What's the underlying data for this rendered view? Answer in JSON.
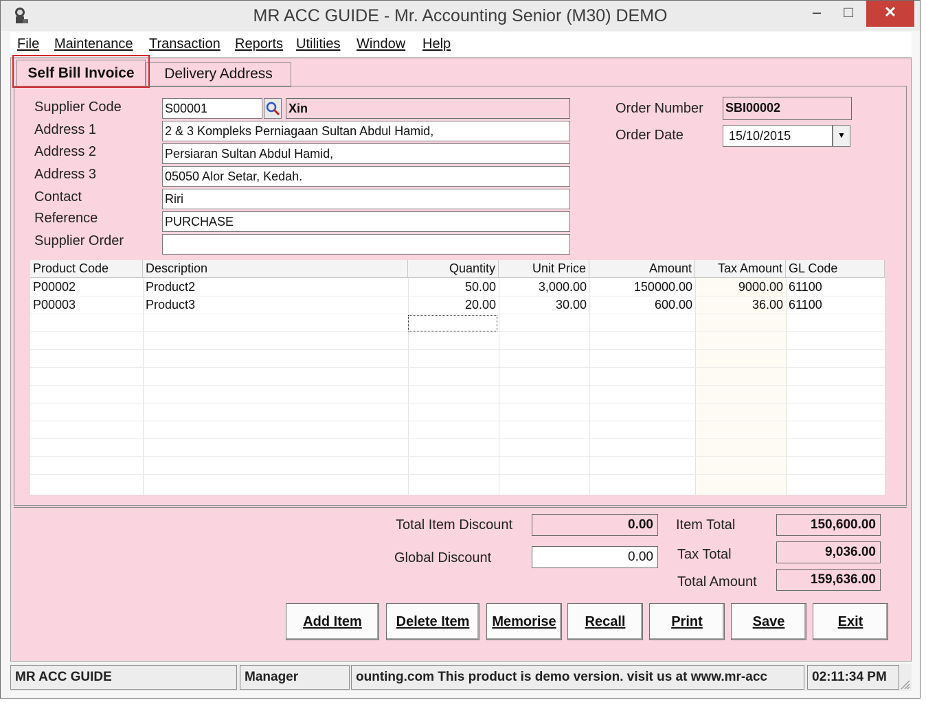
{
  "window": {
    "title": "MR ACC GUIDE - Mr. Accounting Senior (M30) DEMO",
    "min": "–",
    "max": "□",
    "close": "✕"
  },
  "menu": [
    "File",
    "Maintenance",
    "Transaction",
    "Reports",
    "Utilities",
    "Window",
    "Help"
  ],
  "tabs": {
    "active": "Self Bill Invoice",
    "inactive": "Delivery Address"
  },
  "form": {
    "labels": {
      "supplier_code": "Supplier Code",
      "address1": "Address 1",
      "address2": "Address 2",
      "address3": "Address 3",
      "contact": "Contact",
      "reference": "Reference",
      "supplier_order": "Supplier Order",
      "order_number": "Order Number",
      "order_date": "Order Date"
    },
    "supplier_code": "S00001",
    "supplier_name": "Xin",
    "address1": "2 & 3 Kompleks Perniagaan Sultan Abdul Hamid,",
    "address2": "Persiaran Sultan Abdul Hamid,",
    "address3": "05050 Alor Setar, Kedah.",
    "contact": "Riri",
    "reference": "PURCHASE",
    "supplier_order": "",
    "order_number": "SBI00002",
    "order_date": "15/10/2015"
  },
  "grid": {
    "columns": [
      "Product Code",
      "Description",
      "Quantity",
      "Unit Price",
      "Amount",
      "Tax Amount",
      "GL Code"
    ],
    "rows": [
      [
        "P00002",
        "Product2",
        "50.00",
        "3,000.00",
        "150000.00",
        "9000.00",
        "61100"
      ],
      [
        "P00003",
        "Product3",
        "20.00",
        "30.00",
        "600.00",
        "36.00",
        "61100"
      ]
    ]
  },
  "totals": {
    "total_item_discount_label": "Total Item Discount",
    "total_item_discount": "0.00",
    "global_discount_label": "Global Discount",
    "global_discount": "0.00",
    "item_total_label": "Item Total",
    "item_total": "150,600.00",
    "tax_total_label": "Tax Total",
    "tax_total": "9,036.00",
    "total_amount_label": "Total Amount",
    "total_amount": "159,636.00"
  },
  "buttons": {
    "add": "Add Item",
    "delete": "Delete Item",
    "memorise": "Memorise",
    "recall": "Recall",
    "print": "Print",
    "save": "Save",
    "exit": "Exit"
  },
  "status": {
    "app": "MR ACC GUIDE",
    "user": "Manager",
    "message": "ounting.com This product is demo version.  visit us at www.mr-acc",
    "time": "02:11:34 PM"
  },
  "colors": {
    "form_bg": "#fad4df",
    "close_btn": "#c7403a",
    "tab_highlight": "#d8242a"
  }
}
